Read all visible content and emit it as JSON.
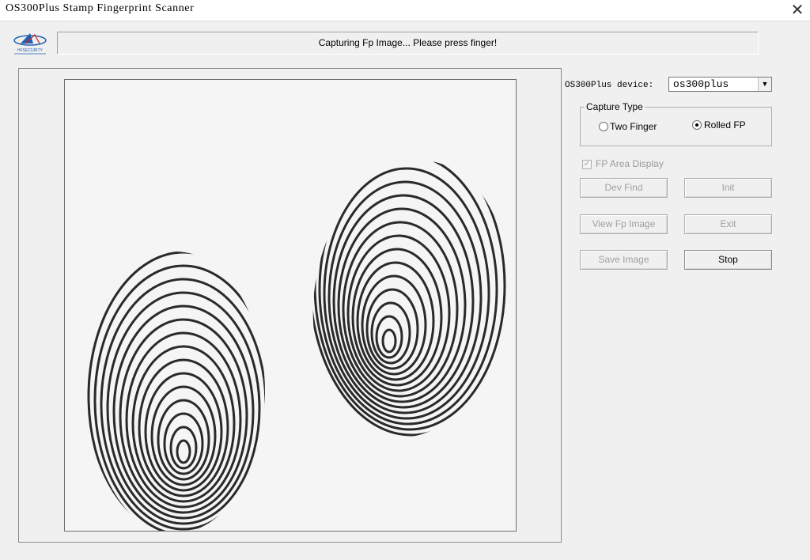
{
  "window": {
    "title": "OS300Plus Stamp Fingerprint Scanner",
    "close_glyph": "✕"
  },
  "logo": {
    "text": "HFSECURITY"
  },
  "status": {
    "message": "Capturing Fp Image... Please press finger!"
  },
  "device": {
    "label": "OS300Plus device:",
    "selected": "os300plus",
    "arrow_glyph": "▼"
  },
  "capture_type": {
    "legend": "Capture Type",
    "options": [
      {
        "label": "Two Finger",
        "selected": false
      },
      {
        "label": "Rolled FP",
        "selected": true
      }
    ]
  },
  "fp_area_display": {
    "label": "FP Area Display",
    "checked": true,
    "enabled": false,
    "check_glyph": "✓"
  },
  "buttons": {
    "dev_find": {
      "label": "Dev Find",
      "enabled": false
    },
    "init": {
      "label": "Init",
      "enabled": false
    },
    "view_fp_image": {
      "label": "View Fp Image",
      "enabled": false
    },
    "exit": {
      "label": "Exit",
      "enabled": false
    },
    "save_image": {
      "label": "Save Image",
      "enabled": false
    },
    "stop": {
      "label": "Stop",
      "enabled": true
    }
  },
  "colors": {
    "accent_logo": "#2060b0",
    "disabled_text": "#a0a0a0"
  }
}
